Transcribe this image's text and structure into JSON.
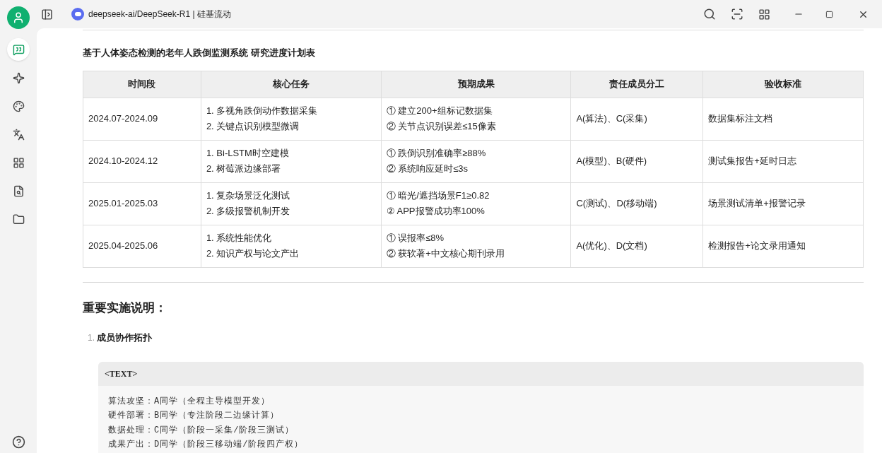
{
  "window": {
    "title": "deepseek-ai/DeepSeek-R1 | 硅基流动"
  },
  "sidebar": {
    "items": [
      {
        "selected": true
      },
      {
        "selected": false
      },
      {
        "selected": false
      },
      {
        "selected": false
      },
      {
        "selected": false
      },
      {
        "selected": false
      },
      {
        "selected": false
      }
    ]
  },
  "document": {
    "table_title": "基于人体姿态检测的老年人跌倒监测系统 研究进度计划表",
    "table": {
      "columns": [
        "时间段",
        "核心任务",
        "预期成果",
        "责任成员分工",
        "验收标准"
      ],
      "rows": [
        {
          "period": "2024.07-2024.09",
          "tasks": [
            "1. 多视角跌倒动作数据采集",
            "2. 关键点识别模型微调"
          ],
          "outcomes": [
            "① 建立200+组标记数据集",
            "② 关节点识别误差≤15像素"
          ],
          "members": "A(算法)、C(采集)",
          "criteria": "数据集标注文档"
        },
        {
          "period": "2024.10-2024.12",
          "tasks": [
            "1. Bi-LSTM时空建模",
            "2. 树莓派边缘部署"
          ],
          "outcomes": [
            "① 跌倒识别准确率≥88%",
            "② 系统响应延时≤3s"
          ],
          "members": "A(模型)、B(硬件)",
          "criteria": "测试集报告+延时日志"
        },
        {
          "period": "2025.01-2025.03",
          "tasks": [
            "1. 复杂场景泛化测试",
            "2. 多级报警机制开发"
          ],
          "outcomes": [
            "① 暗光/遮挡场景F1≥0.82",
            "② APP报警成功率100%"
          ],
          "members": "C(测试)、D(移动端)",
          "criteria": "场景测试清单+报警记录"
        },
        {
          "period": "2025.04-2025.06",
          "tasks": [
            "1. 系统性能优化",
            "2. 知识产权与论文产出"
          ],
          "outcomes": [
            "① 误报率≤8%",
            "② 获软著+中文核心期刊录用"
          ],
          "members": "A(优化)、D(文档)",
          "criteria": "检测报告+论文录用通知"
        }
      ]
    },
    "heading": "重要实施说明：",
    "list": [
      {
        "number": "1.",
        "title": "成员协作拓扑"
      }
    ],
    "code_block": {
      "language": "<TEXT>",
      "lines": [
        "算法攻坚：A同学（全程主导模型开发）",
        "硬件部署：B同学（专注阶段二边缘计算）",
        "数据处理：C同学（阶段一采集/阶段三测试）",
        "成果产出：D同学（阶段三移动端/阶段四产权）"
      ]
    }
  }
}
